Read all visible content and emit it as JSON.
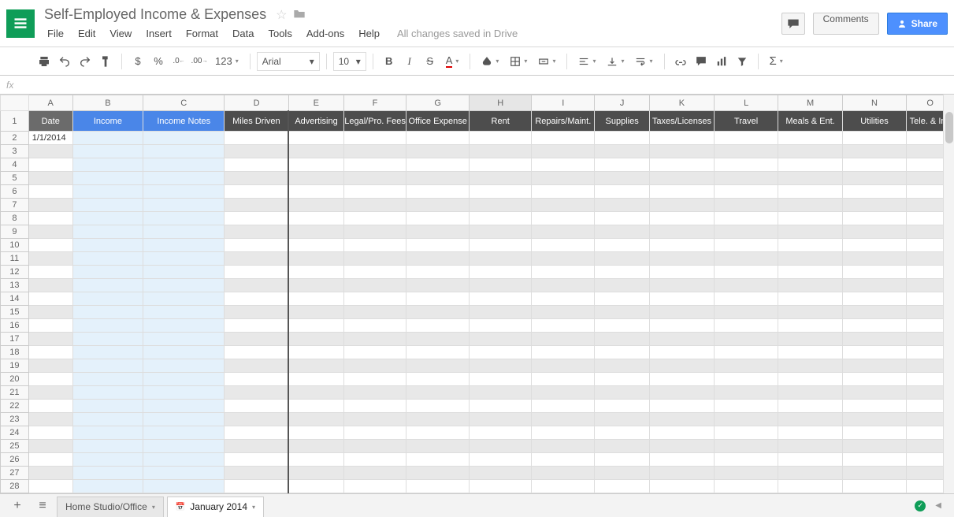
{
  "doc_title": "Self-Employed Income & Expenses",
  "save_state": "All changes saved in Drive",
  "menus": [
    "File",
    "Edit",
    "View",
    "Insert",
    "Format",
    "Data",
    "Tools",
    "Add-ons",
    "Help"
  ],
  "header_buttons": {
    "comments": "Comments",
    "share": "Share"
  },
  "toolbar": {
    "font": "Arial",
    "size": "10",
    "number_fmt": "123",
    "currency": "$",
    "percent": "%",
    "dec_inc": ".0",
    "dec_dec": ".00"
  },
  "formula_bar": {
    "fx": "fx",
    "value": ""
  },
  "columns": [
    "A",
    "B",
    "C",
    "D",
    "E",
    "F",
    "G",
    "H",
    "I",
    "J",
    "K",
    "L",
    "M",
    "N",
    "O"
  ],
  "row_numbers": [
    1,
    2,
    3,
    4,
    5,
    6,
    7,
    8,
    9,
    10,
    11,
    12,
    13,
    14,
    15,
    16,
    17,
    18,
    19,
    20,
    21,
    22,
    23,
    24,
    25,
    26,
    27,
    28
  ],
  "headers_row1": {
    "A": "Date",
    "B": "Income",
    "C": "Income Notes",
    "D": "Miles Driven",
    "E": "Advertising",
    "F": "Legal/Pro. Fees",
    "G": "Office Expense",
    "H": "Rent",
    "I": "Repairs/Maint.",
    "J": "Supplies",
    "K": "Taxes/Licenses",
    "L": "Travel",
    "M": "Meals & Ent.",
    "N": "Utilities",
    "O": "Tele. & Int."
  },
  "data": {
    "A2": "1/1/2014"
  },
  "sheets": {
    "tab1": "Home Studio/Office",
    "tab2": "January 2014",
    "active": "tab2"
  }
}
